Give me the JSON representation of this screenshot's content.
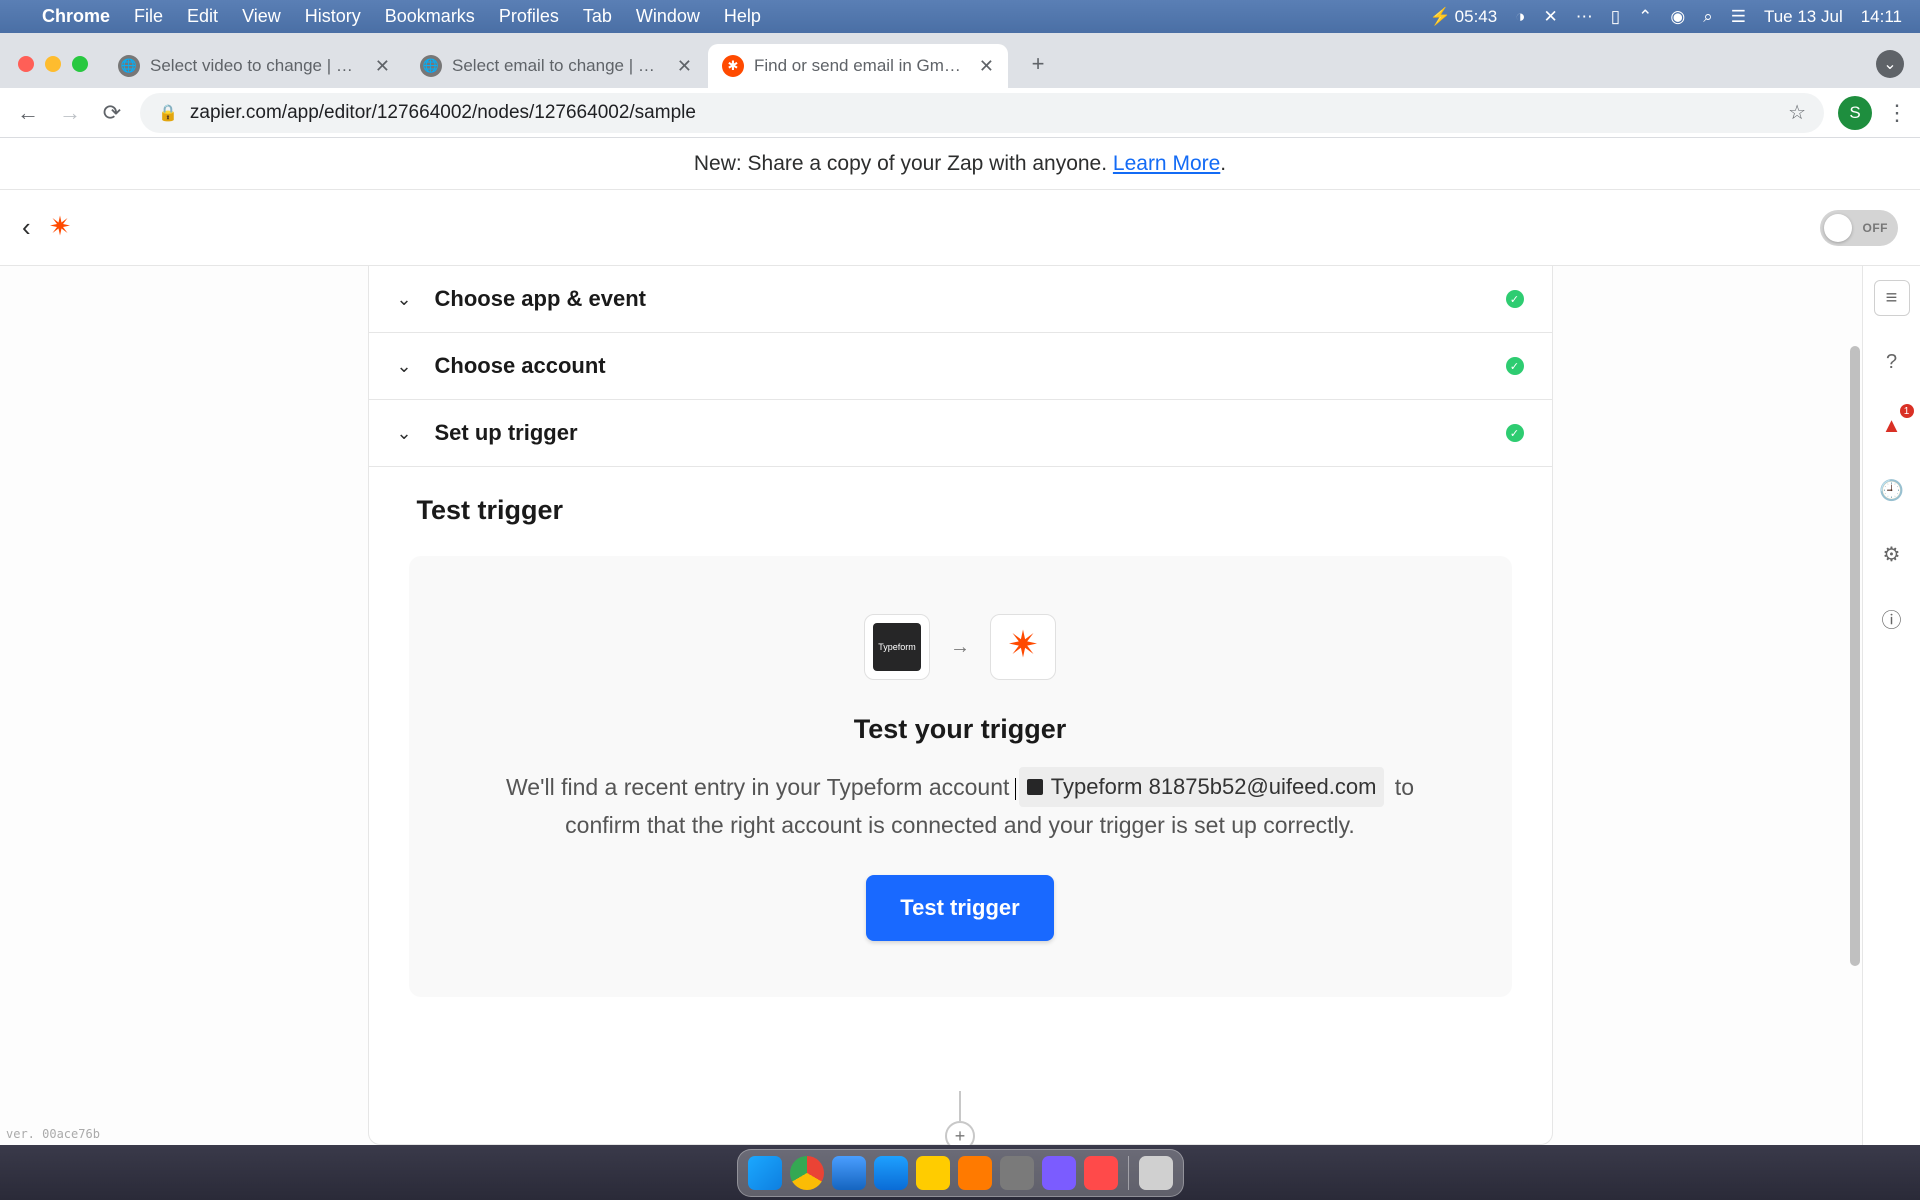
{
  "mac": {
    "app": "Chrome",
    "menus": [
      "File",
      "Edit",
      "View",
      "History",
      "Bookmarks",
      "Profiles",
      "Tab",
      "Window",
      "Help"
    ],
    "battery_time": "05:43",
    "date": "Tue 13 Jul",
    "clock": "14:11"
  },
  "tabs": [
    {
      "title": "Select video to change | Djang",
      "active": false
    },
    {
      "title": "Select email to change | Djang",
      "active": false
    },
    {
      "title": "Find or send email in Gmail wh",
      "active": true
    }
  ],
  "url": "zapier.com/app/editor/127664002/nodes/127664002/sample",
  "profile_initial": "S",
  "banner": {
    "text_before": "New: Share a copy of your Zap with anyone. ",
    "link": "Learn More",
    "text_after": "."
  },
  "toggle": {
    "state": "OFF"
  },
  "sections": {
    "s1": "Choose app & event",
    "s2": "Choose account",
    "s3": "Set up trigger"
  },
  "test": {
    "heading": "Test trigger",
    "box_title": "Test your trigger",
    "desc_before": "We'll find a recent entry in your Typeform account ",
    "chip_label": "Typeform 81875b52@uifeed.com",
    "desc_after": " to confirm that the right account is connected and your trigger is set up correctly.",
    "button": "Test trigger",
    "typeform_logo_text": "Typeform"
  },
  "rail": {
    "alert_count": "1"
  },
  "version": "ver. 00ace76b"
}
